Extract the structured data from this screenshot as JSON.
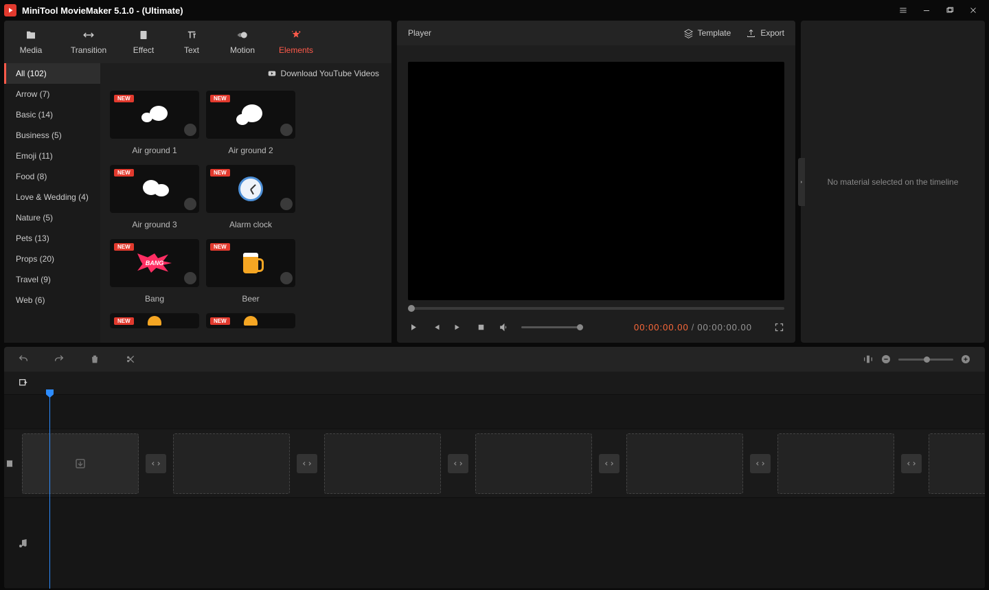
{
  "titlebar": {
    "title": "MiniTool MovieMaker 5.1.0 - (Ultimate)"
  },
  "top_tabs": [
    {
      "name": "media",
      "label": "Media"
    },
    {
      "name": "transition",
      "label": "Transition"
    },
    {
      "name": "effect",
      "label": "Effect"
    },
    {
      "name": "text",
      "label": "Text"
    },
    {
      "name": "motion",
      "label": "Motion"
    },
    {
      "name": "elements",
      "label": "Elements",
      "active": true
    }
  ],
  "download_hint": "Download YouTube Videos",
  "categories": [
    {
      "label": "All (102)",
      "active": true
    },
    {
      "label": "Arrow (7)"
    },
    {
      "label": "Basic (14)"
    },
    {
      "label": "Business (5)"
    },
    {
      "label": "Emoji (11)"
    },
    {
      "label": "Food (8)"
    },
    {
      "label": "Love & Wedding (4)"
    },
    {
      "label": "Nature (5)"
    },
    {
      "label": "Pets (13)"
    },
    {
      "label": "Props (20)"
    },
    {
      "label": "Travel (9)"
    },
    {
      "label": "Web (6)"
    }
  ],
  "elements": [
    {
      "label": "Air ground 1",
      "badge": "NEW",
      "art": "smoke1"
    },
    {
      "label": "Air ground 2",
      "badge": "NEW",
      "art": "smoke2"
    },
    {
      "label": "Air ground 3",
      "badge": "NEW",
      "art": "smoke3"
    },
    {
      "label": "Alarm clock",
      "badge": "NEW",
      "art": "clock"
    },
    {
      "label": "Bang",
      "badge": "NEW",
      "art": "bang",
      "text": "BANG"
    },
    {
      "label": "Beer",
      "badge": "NEW",
      "art": "beer"
    },
    {
      "label": "",
      "badge": "NEW",
      "art": "bell-mini",
      "partial": true
    },
    {
      "label": "",
      "badge": "NEW",
      "art": "bell-mini",
      "partial": true
    }
  ],
  "player": {
    "title": "Player",
    "template_label": "Template",
    "export_label": "Export",
    "current_time": "00:00:00.00",
    "separator": "/",
    "total_time": "00:00:00.00"
  },
  "inspector": {
    "empty_message": "No material selected on the timeline"
  }
}
